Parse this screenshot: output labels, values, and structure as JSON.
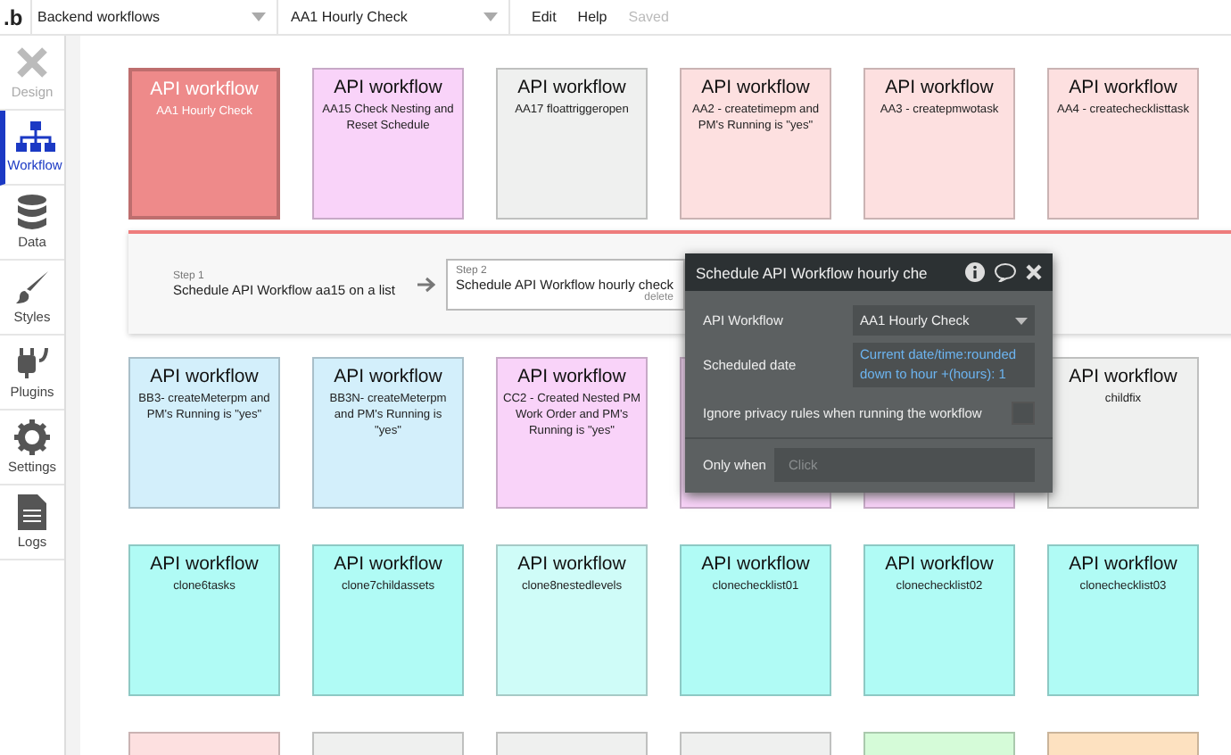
{
  "topbar": {
    "logo": ".b",
    "page_dropdown": "Backend workflows",
    "workflow_dropdown": "AA1 Hourly Check",
    "menu": [
      {
        "label": "Edit",
        "disabled": false
      },
      {
        "label": "Help",
        "disabled": false
      },
      {
        "label": "Saved",
        "disabled": true
      }
    ]
  },
  "sidebar": {
    "items": [
      {
        "label": "Design",
        "kind": "design",
        "selected": false,
        "disabled": true
      },
      {
        "label": "Workflow",
        "kind": "workflow",
        "selected": true,
        "disabled": false
      },
      {
        "label": "Data",
        "kind": "data",
        "selected": false,
        "disabled": false
      },
      {
        "label": "Styles",
        "kind": "styles",
        "selected": false,
        "disabled": false
      },
      {
        "label": "Plugins",
        "kind": "plugins",
        "selected": false,
        "disabled": false
      },
      {
        "label": "Settings",
        "kind": "settings",
        "selected": false,
        "disabled": false
      },
      {
        "label": "Logs",
        "kind": "logs",
        "selected": false,
        "disabled": false
      }
    ]
  },
  "rows": [
    {
      "cards": [
        {
          "title": "API workflow",
          "name": "AA1 Hourly Check",
          "color": "#ee8a8a",
          "selected": true
        },
        {
          "title": "API workflow",
          "name": "AA15 Check Nesting and Reset Schedule",
          "color": "#f9d3f9",
          "selected": false
        },
        {
          "title": "API workflow",
          "name": "AA17 floattriggeropen",
          "color": "#eff0ef",
          "selected": false
        },
        {
          "title": "API workflow",
          "name": "AA2 - createtimepm and PM's Running is \"yes\"",
          "color": "#fde0e0",
          "selected": false
        },
        {
          "title": "API workflow",
          "name": "AA3 - createpmwotask",
          "color": "#fde0e0",
          "selected": false
        },
        {
          "title": "API workflow",
          "name": "AA4 - createchecklisttask",
          "color": "#fde0e0",
          "selected": false
        }
      ]
    },
    {
      "cards": [
        {
          "title": "API workflow",
          "name": "BB3- createMeterpm and PM's Running is \"yes\"",
          "color": "#d3effb",
          "selected": false
        },
        {
          "title": "API workflow",
          "name": "BB3N- createMeterpm and PM's Running is \"yes\"",
          "color": "#d3effb",
          "selected": false
        },
        {
          "title": "API workflow",
          "name": "CC2 - Created Nested PM Work Order and PM's Running is \"yes\"",
          "color": "#f9d3f9",
          "selected": false
        },
        {
          "color": "#f9d3f9",
          "selected": false
        },
        {
          "color": "#f9d3f9",
          "selected": false
        },
        {
          "title": "API workflow",
          "name": "childfix",
          "color": "#eff0ef",
          "selected": false
        }
      ]
    },
    {
      "cards": [
        {
          "title": "API workflow",
          "name": "clone6tasks",
          "color": "#b0fbf5",
          "selected": false
        },
        {
          "title": "API workflow",
          "name": "clone7childassets",
          "color": "#b0fbf5",
          "selected": false
        },
        {
          "title": "API workflow",
          "name": "clone8nestedlevels",
          "color": "#cffcf8",
          "selected": false
        },
        {
          "title": "API workflow",
          "name": "clonechecklist01",
          "color": "#b0fbf5",
          "selected": false
        },
        {
          "title": "API workflow",
          "name": "clonechecklist02",
          "color": "#b0fbf5",
          "selected": false
        },
        {
          "title": "API workflow",
          "name": "clonechecklist03",
          "color": "#b0fbf5",
          "selected": false
        }
      ]
    },
    {
      "cards": [
        {
          "color": "#fde0e0",
          "selected": false
        },
        {
          "color": "#eff0ef",
          "selected": false
        },
        {
          "color": "#eff0ef",
          "selected": false
        },
        {
          "color": "#eff0ef",
          "selected": false
        },
        {
          "color": "#d5fbd8",
          "selected": false
        },
        {
          "color": "#fde1c0",
          "selected": false
        }
      ]
    }
  ],
  "steps": [
    {
      "label": "Step 1",
      "action": "Schedule API Workflow aa15 on a list",
      "selected": false
    },
    {
      "label": "Step 2",
      "action": "Schedule API Workflow hourly check",
      "delete": "delete",
      "selected": true
    }
  ],
  "popup": {
    "title": "Schedule API Workflow hourly che",
    "api_workflow_label": "API Workflow",
    "api_workflow_value": "AA1 Hourly Check",
    "scheduled_label": "Scheduled date",
    "scheduled_value": "Current date/time:rounded down to hour +(hours): 1",
    "ignore_privacy_label": "Ignore privacy rules when running the workflow",
    "ignore_privacy_checked": false,
    "only_when_label": "Only when",
    "only_when_placeholder": "Click"
  }
}
